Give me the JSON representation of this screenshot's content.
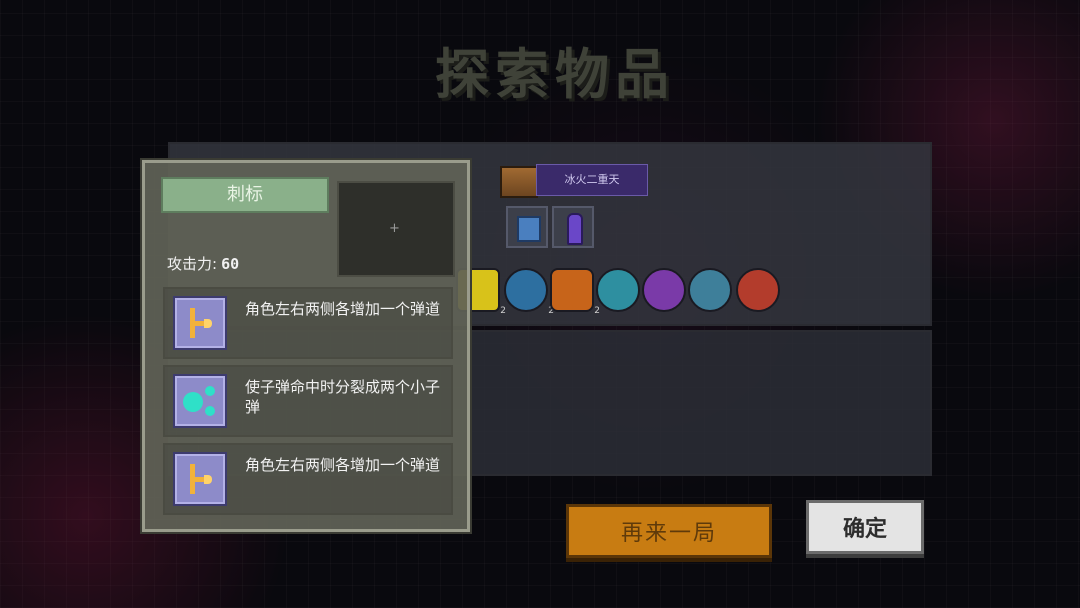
{
  "screen": {
    "title": "探索物品"
  },
  "weapon": {
    "name": "冰火二重天"
  },
  "items": [
    {
      "icon": "yellow-chest-icon",
      "color": "#d8c21a",
      "count": "2"
    },
    {
      "icon": "blue-disc-icon",
      "color": "#2d6fa0",
      "count": "2"
    },
    {
      "icon": "orange-ring-icon",
      "color": "#c7641a",
      "count": "2"
    },
    {
      "icon": "ice-crystal-icon",
      "color": "#2e8fa0",
      "count": ""
    },
    {
      "icon": "purple-gem-icon",
      "color": "#7a3aa8",
      "count": ""
    },
    {
      "icon": "fan-blade-icon",
      "color": "#3e7f9a",
      "count": ""
    },
    {
      "icon": "red-shield-icon",
      "color": "#b33c2c",
      "count": ""
    }
  ],
  "buttons": {
    "retry": "再来一局",
    "confirm": "确定"
  },
  "tooltip": {
    "name": "刺标",
    "attack_label": "攻击力:",
    "attack_value": "60",
    "preview_mark": "+",
    "perks": [
      {
        "icon": "side-barrel-icon",
        "text": "角色左右两侧各增加一个弹道"
      },
      {
        "icon": "split-bullet-icon",
        "text": "使子弹命中时分裂成两个小子弹"
      },
      {
        "icon": "side-barrel-icon",
        "text": "角色左右两侧各增加一个弹道"
      }
    ]
  }
}
